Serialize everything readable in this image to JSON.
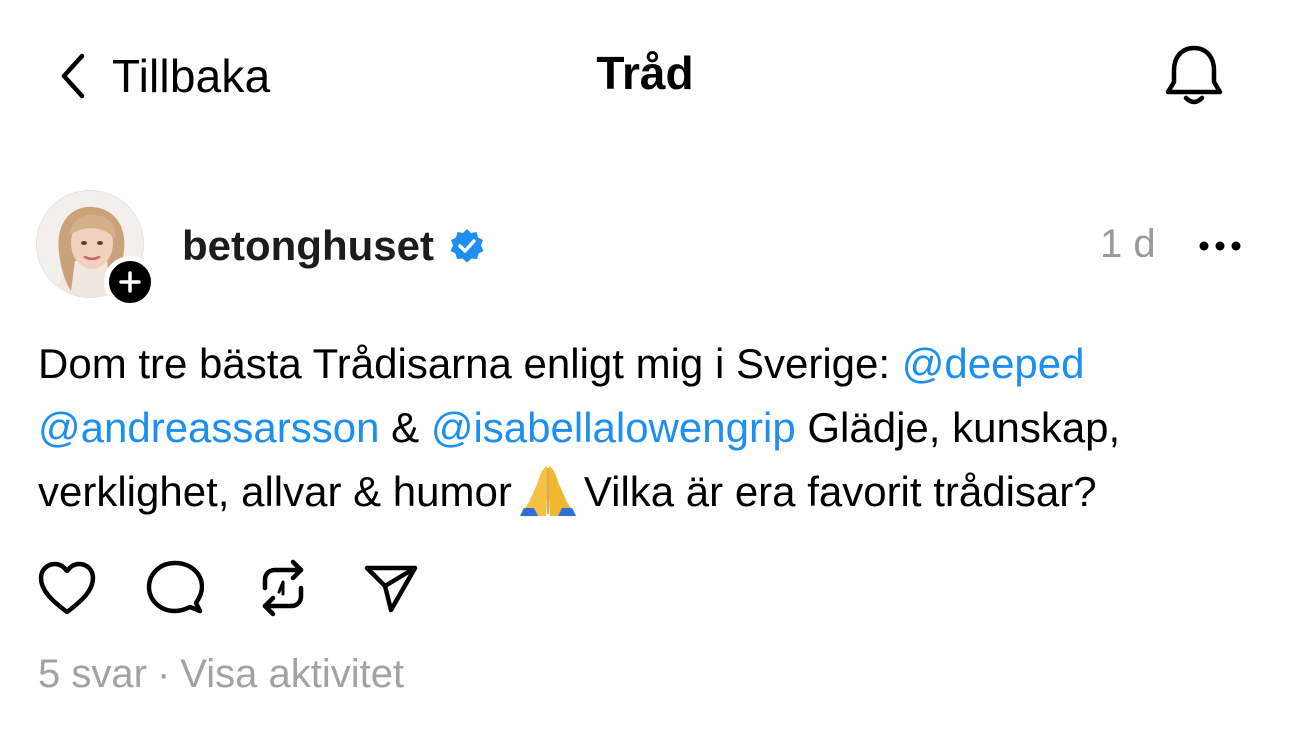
{
  "header": {
    "back_label": "Tillbaka",
    "title": "Tråd",
    "back_icon": "chevron-left-icon",
    "notify_icon": "bell-icon"
  },
  "post": {
    "username": "betonghuset",
    "verified": true,
    "timestamp": "1 d",
    "text_segments": {
      "line1_a": "Dom tre bästa Trådisarna enligt mig i Sverige: ",
      "mention_1": "@deeped",
      "mention_2": "@andreassarsson",
      "line2_b": " & ",
      "mention_3": "@isabellalowengrip",
      "line2_d": " Glädje, kunskap,",
      "line3_a": "verklighet, allvar & humor",
      "emoji": "🙏",
      "line3_b": "Vilka är era favorit trådisar?"
    },
    "actions": [
      "heart-icon",
      "comment-icon",
      "repost-icon",
      "share-icon"
    ]
  },
  "meta": {
    "replies": "5 svar",
    "separator": "·",
    "activity_link": "Visa aktivitet"
  },
  "colors": {
    "mention": "#1d8ff1",
    "verified_badge": "#1d8ff1",
    "muted_text": "#9a9a9a"
  }
}
